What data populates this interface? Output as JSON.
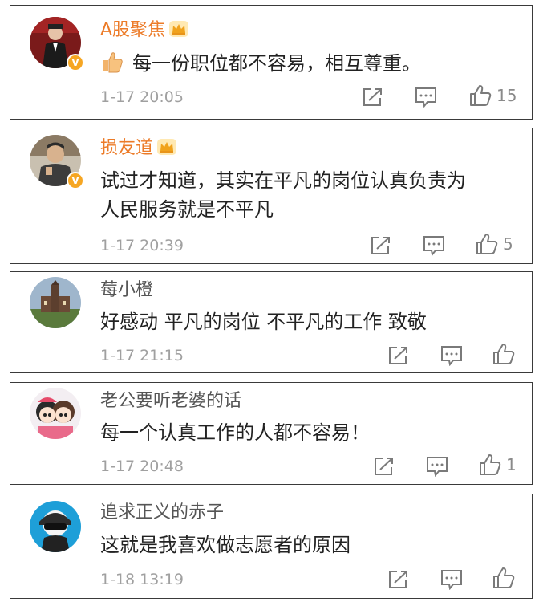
{
  "comments": [
    {
      "user": "A股聚焦",
      "vip": true,
      "verified": true,
      "text": "每一份职位都不容易，相互尊重。",
      "emoji": "thumbs-up",
      "time": "1-17 20:05",
      "likes": "15"
    },
    {
      "user": "损友道",
      "vip": true,
      "verified": true,
      "text_lines": [
        "试过才知道，其实在平凡的岗位认真负责为",
        "人民服务就是不平凡"
      ],
      "time": "1-17 20:39",
      "likes": "5"
    },
    {
      "user": "莓小橙",
      "vip": false,
      "text": "好感动 平凡的岗位 不平凡的工作 致敬",
      "time": "1-17 21:15",
      "likes": ""
    },
    {
      "user": "老公要听老婆的话",
      "vip": false,
      "text": "每一个认真工作的人都不容易！",
      "time": "1-17 20:48",
      "likes": "1"
    },
    {
      "user": "追求正义的赤子",
      "vip": false,
      "text": "这就是我喜欢做志愿者的原因",
      "time": "1-18 13:19",
      "likes": ""
    }
  ],
  "colors": {
    "vip_name": "#ec7b28",
    "normal_name": "#555555",
    "text": "#222222",
    "meta": "#a0a0a0",
    "verified_badge": "#f6a623"
  },
  "icons": [
    "share-icon",
    "comment-icon",
    "like-icon",
    "crown-icon",
    "verified-badge"
  ]
}
